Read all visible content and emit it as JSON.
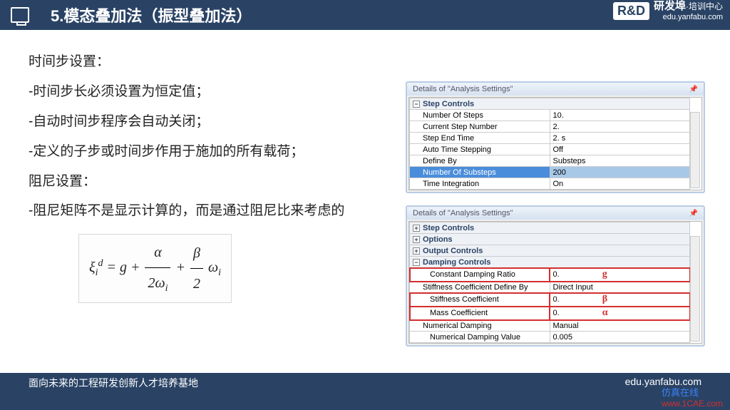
{
  "header": {
    "title": "5.模态叠加法（振型叠加法）",
    "brand_main": "研发埠",
    "brand_sub": "·培训中心",
    "brand_url": "edu.yanfabu.com",
    "rd": "R&D"
  },
  "text": {
    "p1": "时间步设置：",
    "p2": "-时间步长必须设置为恒定值；",
    "p3": "-自动时间步程序会自动关闭；",
    "p4": "-定义的子步或时间步作用于施加的所有载荷；",
    "p5": "阻尼设置：",
    "p6": "-阻尼矩阵不是显示计算的，而是通过阻尼比来考虑的"
  },
  "panel1": {
    "title": "Details of \"Analysis Settings\"",
    "section": "Step Controls",
    "rows": [
      {
        "label": "Number Of Steps",
        "value": "10."
      },
      {
        "label": "Current Step Number",
        "value": "2."
      },
      {
        "label": "Step End Time",
        "value": "2. s"
      },
      {
        "label": "Auto Time Stepping",
        "value": "Off"
      },
      {
        "label": "Define By",
        "value": "Substeps"
      },
      {
        "label": "Number Of Substeps",
        "value": "200"
      },
      {
        "label": "Time Integration",
        "value": "On"
      }
    ]
  },
  "panel2": {
    "title": "Details of \"Analysis Settings\"",
    "sections": {
      "s1": "Step Controls",
      "s2": "Options",
      "s3": "Output Controls",
      "s4": "Damping Controls"
    },
    "rows": {
      "constant_damping_ratio": {
        "label": "Constant Damping Ratio",
        "value": "0.",
        "symbol": "g"
      },
      "stiffness_define_by": {
        "label": "Stiffness Coefficient Define By",
        "value": "Direct Input"
      },
      "stiffness_coeff": {
        "label": "Stiffness Coefficient",
        "value": "0.",
        "symbol": "β"
      },
      "mass_coeff": {
        "label": "Mass Coefficient",
        "value": "0.",
        "symbol": "α"
      },
      "numerical_damping": {
        "label": "Numerical Damping",
        "value": "Manual"
      },
      "numerical_damping_value": {
        "label": "Numerical Damping Value",
        "value": "0.005"
      }
    }
  },
  "footer": {
    "left": "面向未来的工程研发创新人才培养基地",
    "right": "edu.yanfabu.com"
  },
  "watermark": {
    "l1": "仿真在线",
    "l2": "www.1CAE.com"
  }
}
